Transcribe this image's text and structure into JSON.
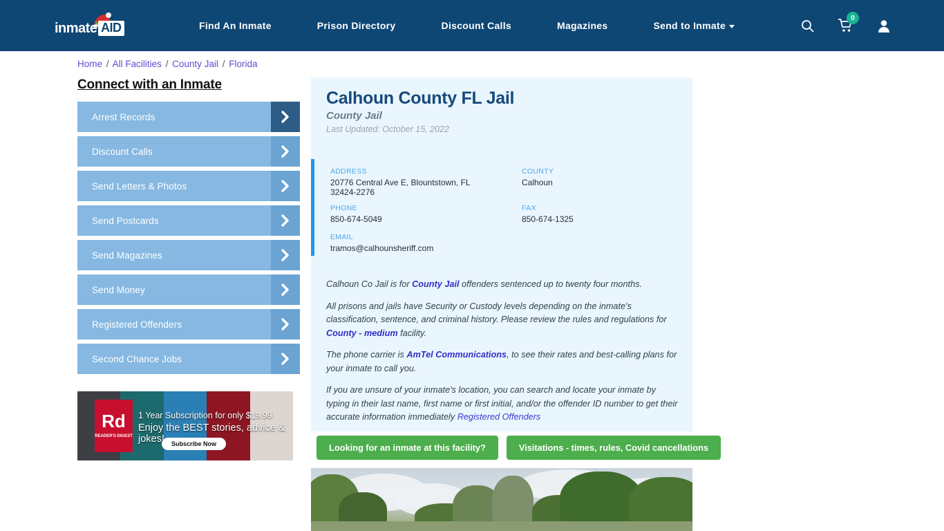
{
  "navbar": {
    "logo_text": "inmate",
    "logo_badge": "AID",
    "logo_icon": "santa-hat-icon",
    "links": [
      {
        "label": "Find An Inmate",
        "has_caret": false
      },
      {
        "label": "Prison Directory",
        "has_caret": false
      },
      {
        "label": "Discount Calls",
        "has_caret": false
      },
      {
        "label": "Magazines",
        "has_caret": false
      },
      {
        "label": "Send to Inmate",
        "has_caret": true
      }
    ],
    "icons": {
      "search": "search-icon",
      "cart": "shopping-cart-icon",
      "cart_count": "0",
      "account": "user-account-icon"
    },
    "bg_color": "#0e4674",
    "badge_color": "#19b394"
  },
  "breadcrumb": {
    "items": [
      "Home",
      "All Facilities",
      "County Jail",
      "Florida"
    ],
    "separator": "/",
    "link_color": "#5a4fcf"
  },
  "sidebar": {
    "title": "Connect with an Inmate",
    "items": [
      {
        "label": "Arrest Records",
        "active": true
      },
      {
        "label": "Discount Calls",
        "active": false
      },
      {
        "label": "Send Letters & Photos",
        "active": false
      },
      {
        "label": "Send Postcards",
        "active": false
      },
      {
        "label": "Send Magazines",
        "active": false
      },
      {
        "label": "Send Money",
        "active": false
      },
      {
        "label": "Registered Offenders",
        "active": false
      },
      {
        "label": "Second Chance Jobs",
        "active": false
      }
    ],
    "button_color": "#86b8e2",
    "chevron_color": "#6ba3d2",
    "chevron_active_color": "#2d5d86",
    "ad": {
      "brand": "Rd",
      "brand_sub": "READER'S DIGEST",
      "line1": "1 Year Subscription for only $19.99",
      "line2": "Enjoy the BEST stories, advice & jokes!",
      "cta": "Subscribe Now",
      "cover_title": "Reader's digest"
    }
  },
  "facility": {
    "title": "Calhoun County FL Jail",
    "subtitle": "County Jail",
    "last_updated": "Last Updated: October 15, 2022",
    "details": {
      "address_label": "ADDRESS",
      "address_value": "20776 Central Ave E, Blountstown, FL 32424-2276",
      "county_label": "COUNTY",
      "county_value": "Calhoun",
      "phone_label": "PHONE",
      "phone_value": "850-674-5049",
      "fax_label": "FAX",
      "fax_value": "850-674-1325",
      "email_label": "EMAIL",
      "email_value": "tramos@calhounsheriff.com"
    },
    "paragraphs": {
      "p1_a": "Calhoun Co Jail is for ",
      "p1_link": "County Jail",
      "p1_b": " offenders sentenced up to twenty four months.",
      "p2_a": "All prisons and jails have Security or Custody levels depending on the inmate's classification, sentence, and criminal history. Please review the rules and regulations for ",
      "p2_link": "County - medium",
      "p2_b": " facility.",
      "p3_a": "The phone carrier is ",
      "p3_link": "AmTel Communications",
      "p3_b": ", to see their rates and best-calling plans for your inmate to call you.",
      "p4_a": "If you are unsure of your inmate's location, you can search and locate your inmate by typing in their last name, first name or first initial, and/or the offender ID number to get their accurate information immediately ",
      "p4_link": "Registered Offenders"
    },
    "card_bg": "#eaf6fd",
    "accent_bar_color": "#2196f3"
  },
  "actions": {
    "inmate_search_label": "Looking for an inmate at this facility?",
    "visitations_label": "Visitations - times, rules, Covid cancellations",
    "button_color": "#4cae4c"
  },
  "photo": {
    "alt": "facility-exterior-trees-photo"
  }
}
